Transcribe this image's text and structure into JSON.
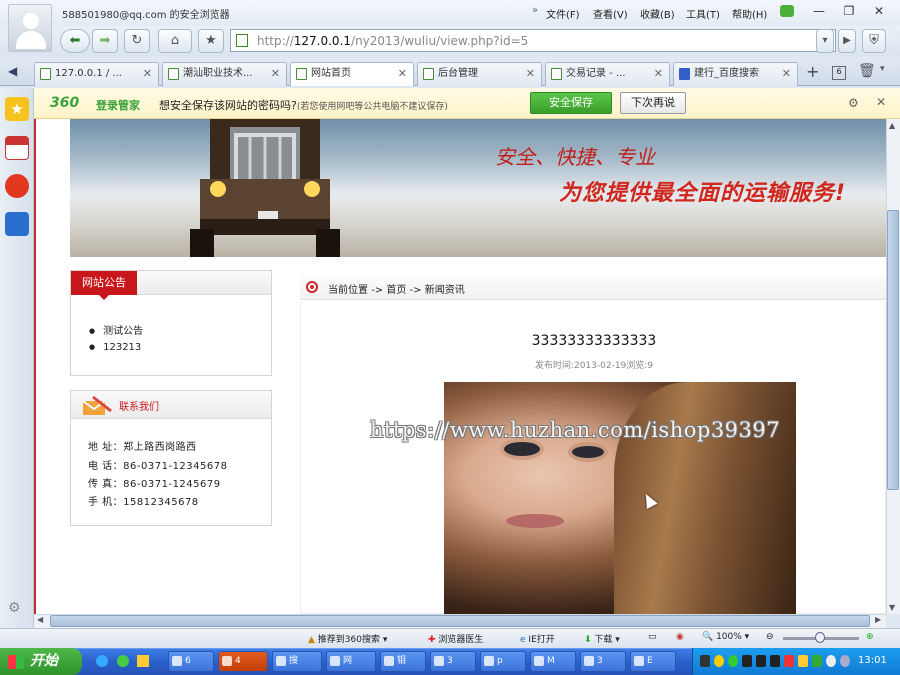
{
  "window": {
    "title": "588501980@qq.com 的安全浏览器",
    "menus": [
      "文件(F)",
      "查看(V)",
      "收藏(B)",
      "工具(T)",
      "帮助(H)"
    ]
  },
  "nav": {
    "url_host": "127.0.0.1",
    "url_path": "/ny2013/wuliu/view.php?id=5",
    "url_prefix": "http://"
  },
  "tabs": [
    {
      "label": "127.0.0.1 / ..."
    },
    {
      "label": "潮汕职业技术..."
    },
    {
      "label": "网站首页"
    },
    {
      "label": "后台管理"
    },
    {
      "label": "交易记录 - ..."
    },
    {
      "label": "建行_百度搜索"
    }
  ],
  "bar360": {
    "logo": "360",
    "manager": "登录管家",
    "prompt": "想安全保存该网站的密码吗?",
    "hint": "(若您使用网吧等公共电脑不建议保存)",
    "save": "安全保存",
    "later": "下次再说"
  },
  "banner": {
    "slogan1": "安全、快捷、专业",
    "slogan2": "为您提供最全面的运输服务!"
  },
  "notice": {
    "title": "网站公告",
    "items": [
      "测试公告",
      "123213"
    ]
  },
  "contact": {
    "title": "联系我们",
    "address": "地 址：郑上路西岗路西",
    "phone": "电 话：86-0371-12345678",
    "fax": "传 真：86-0371-1245679",
    "mobile": "手 机：15812345678"
  },
  "breadcrumb": {
    "label": "当前位置",
    "path": "-> 首页 -> 新闻资讯"
  },
  "article": {
    "title": "33333333333333",
    "meta": "发布时间:2013-02-19浏览:9"
  },
  "watermark": "https://www.huzhan.com/ishop39397",
  "status": {
    "recommend": "推荐到360搜索",
    "doctor": "浏览器医生",
    "ie": "IE打开",
    "download": "下载",
    "zoom": "100%"
  },
  "taskbar": {
    "start": "开始",
    "items": [
      "6",
      "4",
      "搜",
      "网",
      "钼",
      "3",
      "p",
      "M",
      "3",
      "E"
    ],
    "clock": "13:01"
  },
  "colors": {
    "accent_red": "#c8161d",
    "green_360": "#39a33a",
    "taskbar_blue": "#2a5fc9"
  }
}
